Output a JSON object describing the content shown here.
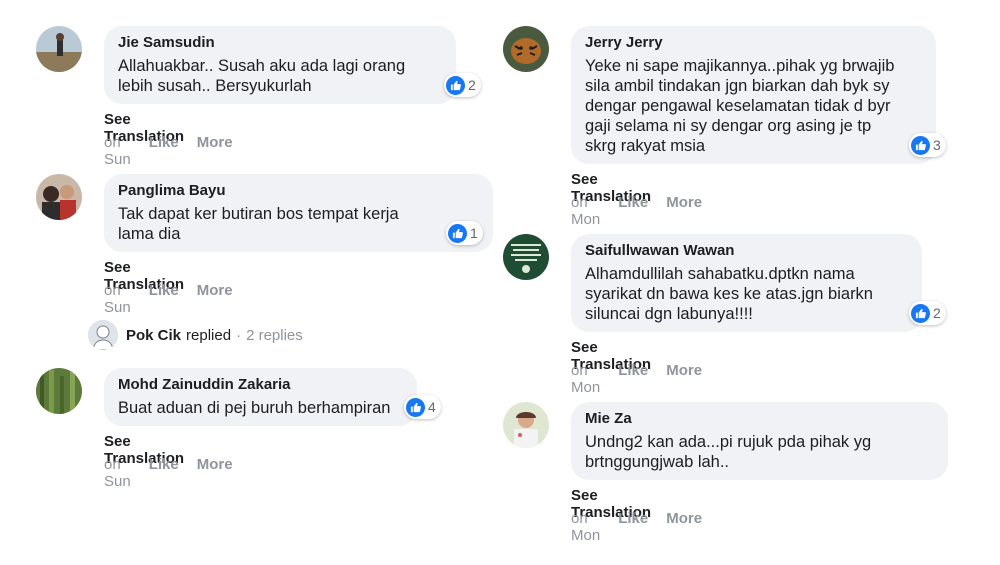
{
  "left_column": [
    {
      "author": "Jie Samsudin",
      "text": "Allahuakbar.. Susah aku ada lagi orang\nlebih susah.. Bersyukurlah",
      "likes": "2",
      "see_translation": "See Translation",
      "time": "on Sun",
      "like_label": "Like",
      "more_label": "More"
    },
    {
      "author": "Panglima Bayu",
      "text": "Tak dapat ker butiran bos tempat kerja\nlama dia",
      "likes": "1",
      "see_translation": "See Translation",
      "time": "on Sun",
      "like_label": "Like",
      "more_label": "More"
    },
    {
      "author": "Mohd Zainuddin Zakaria",
      "text": "Buat aduan di pej buruh berhampiran",
      "likes": "4",
      "see_translation": "See Translation",
      "time": "on Sun",
      "like_label": "Like",
      "more_label": "More"
    }
  ],
  "replies_row": {
    "name": "Pok Cik",
    "verb": "replied",
    "separator": "·",
    "count": "2 replies"
  },
  "right_column": [
    {
      "author": "Jerry Jerry",
      "text": "Yeke ni sape majikannya..pihak yg brwajib\nsila ambil tindakan jgn biarkan dah byk sy\ndengar pengawal keselamatan tidak d byr\ngaji selama ni sy dengar org asing je tp\nskrg rakyat msia",
      "likes": "3",
      "see_translation": "See Translation",
      "time": "on Mon",
      "like_label": "Like",
      "more_label": "More"
    },
    {
      "author": "Saifullwawan Wawan",
      "text": "Alhamdullilah sahabatku.dptkn nama\nsyarikat dn bawa kes ke atas.jgn biarkn\nsiluncai dgn labunya!!!!",
      "likes": "2",
      "see_translation": "See Translation",
      "time": "on Mon",
      "like_label": "Like",
      "more_label": "More"
    },
    {
      "author": "Mie Za",
      "text": "Undng2 kan ada...pi rujuk pda pihak yg\nbrtnggungjwab lah..",
      "see_translation": "See Translation",
      "time": "on Mon",
      "like_label": "Like",
      "more_label": "More"
    }
  ],
  "colors": {
    "bubble": "#f0f2f5",
    "like_blue": "#1877f2",
    "muted": "#90949c"
  }
}
